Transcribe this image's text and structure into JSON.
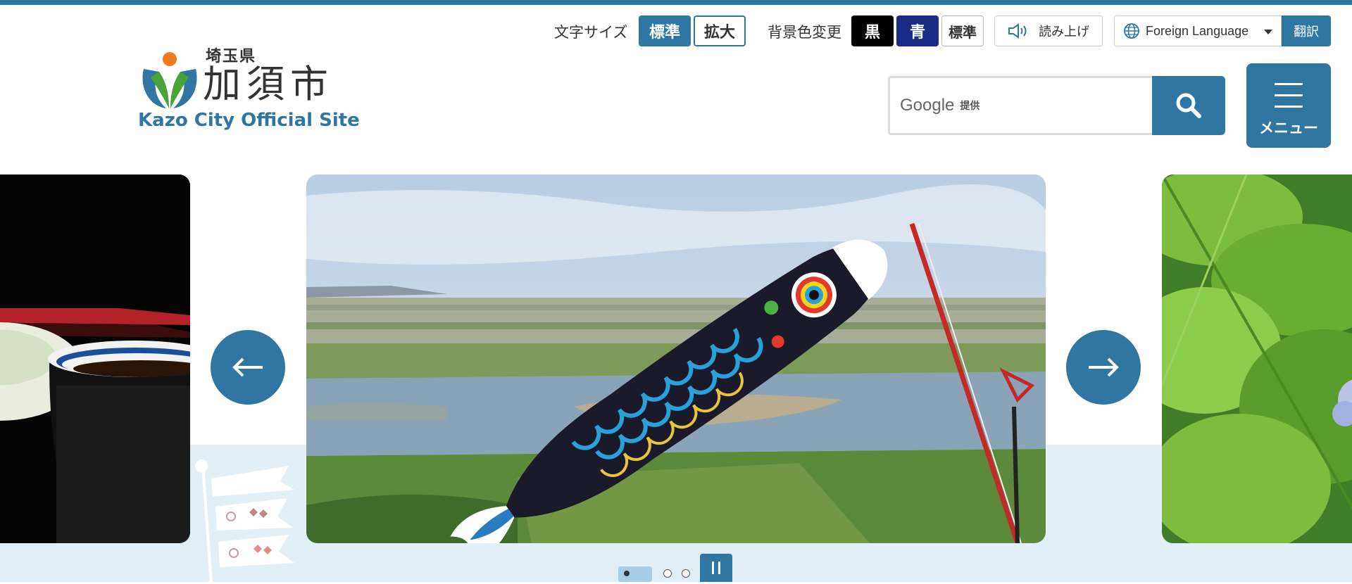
{
  "header": {
    "logo": {
      "prefecture": "埼玉県",
      "city": "加須市",
      "subtitle": "Kazo City Official Site"
    },
    "font_size": {
      "label": "文字サイズ",
      "standard": "標準",
      "large": "拡大"
    },
    "background": {
      "label": "背景色変更",
      "black": "黒",
      "blue": "青",
      "standard": "標準"
    },
    "read_aloud": "読み上げ",
    "language": {
      "selected": "Foreign Language",
      "translate": "翻訳"
    },
    "search": {
      "google": "Google",
      "provided": "提供"
    },
    "menu": "メニュー"
  },
  "carousel": {
    "slides": 3,
    "active_index": 1,
    "colors": {
      "accent": "#2f76a3",
      "sky": "#c9d9e8"
    }
  }
}
